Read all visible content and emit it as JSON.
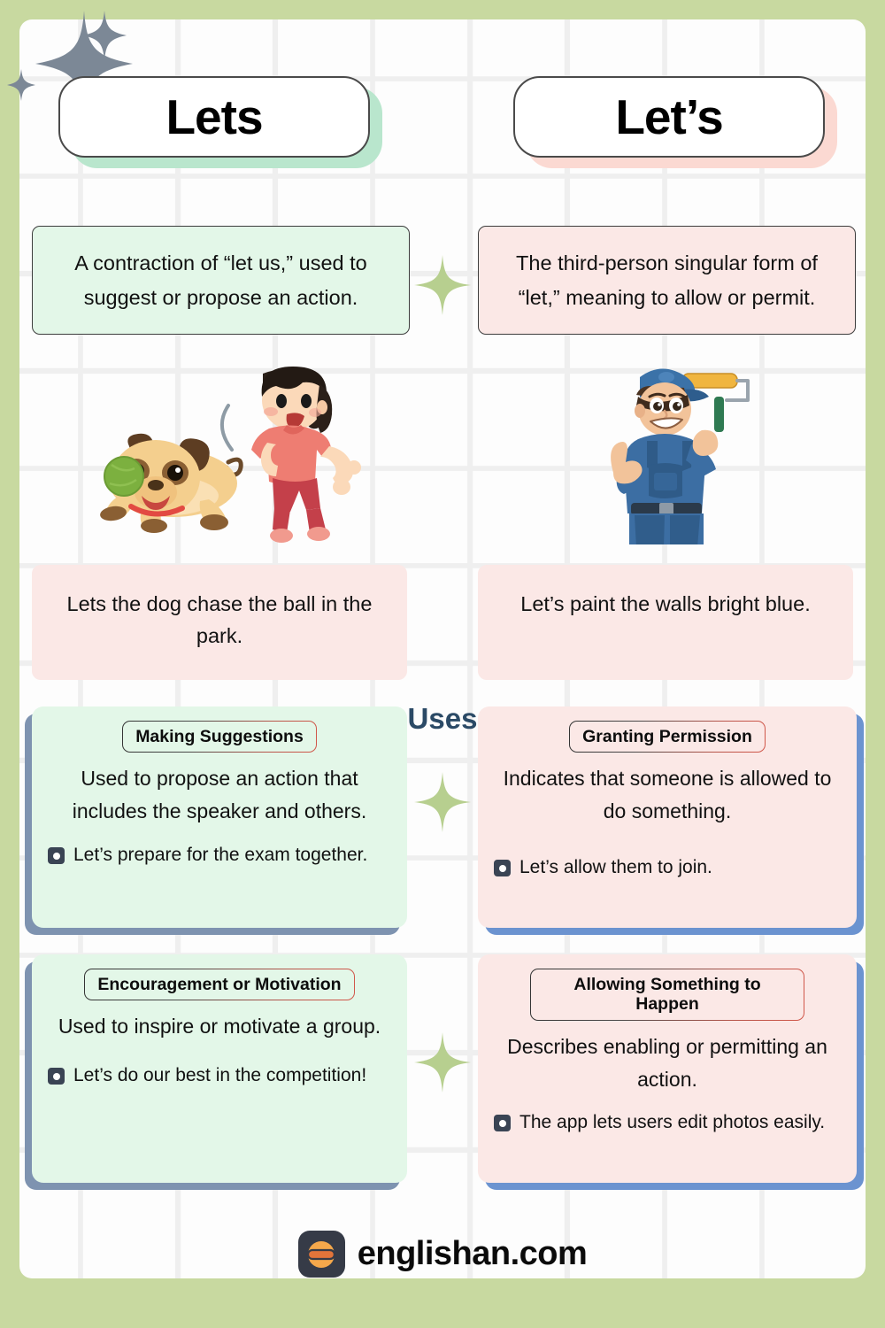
{
  "theme": {
    "background_green": "#c8d9a0",
    "card_green": "#e3f7e8",
    "card_pink": "#fbe8e6",
    "shadow_slate": "#7e93b0",
    "shadow_blue": "#6b93d0",
    "uses_heading_color": "#2b4a66",
    "badge_border_gradient_start": "#333333",
    "badge_border_gradient_end": "#d2574a",
    "logo_dark": "#363b47",
    "logo_orange": "#f5a84b",
    "logo_accent": "#e2743a"
  },
  "columns": {
    "left": {
      "title": "Lets",
      "title_shadow_color": "#b9e6cd",
      "definition": "A contraction of “let us,” used to suggest or propose an action.",
      "illustration_name": "girl-throwing-ball-with-dog-illustration",
      "example": "Lets the dog chase the ball in the park."
    },
    "right": {
      "title": "Let’s",
      "title_shadow_color": "#fbd9d2",
      "definition": "The third-person singular form of “let,” meaning to allow or permit.",
      "illustration_name": "painter-with-paint-roller-illustration",
      "example": "Let’s paint the walls bright blue."
    }
  },
  "uses": {
    "heading": "Uses",
    "cards": [
      {
        "side": "left",
        "row": 1,
        "badge": "Making Suggestions",
        "description": "Used to propose an action that includes the speaker and others.",
        "example": "Let’s prepare for the exam together."
      },
      {
        "side": "right",
        "row": 1,
        "badge": "Granting Permission",
        "description": "Indicates that someone is allowed to do something.",
        "example": "Let’s allow them to join."
      },
      {
        "side": "left",
        "row": 2,
        "badge": "Encouragement or Motivation",
        "description": "Used to inspire or motivate a group.",
        "example": "Let’s do our best in the competition!"
      },
      {
        "side": "right",
        "row": 2,
        "badge": "Allowing Something to Happen",
        "description": "Describes enabling or permitting an action.",
        "example": "The app lets users edit photos easily."
      }
    ]
  },
  "footer": {
    "brand": "englishan.com",
    "logo_icon": "englishan-e-logo-icon"
  }
}
